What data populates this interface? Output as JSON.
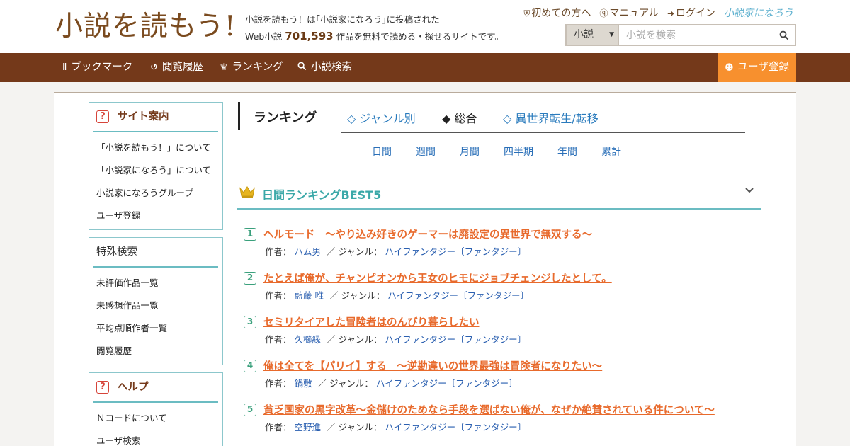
{
  "header": {
    "logo": "小説を読もう!",
    "tagline_line1": "小説を読もう！は｢小説家になろう｣に投稿された",
    "tagline_prefix": "Web小説",
    "work_count": "701,593",
    "tagline_suffix": "作品を無料で読める・探せるサイトです。",
    "links": [
      {
        "icon": "shield-icon",
        "label": "初めての方へ"
      },
      {
        "icon": "question-circle-icon",
        "label": "マニュアル"
      },
      {
        "icon": "login-icon",
        "label": "ログイン"
      }
    ],
    "narou_logo": "小説家になろう",
    "search": {
      "select_value": "小説",
      "placeholder": "小説を検索"
    }
  },
  "nav": {
    "items": [
      {
        "icon": "bookmark-icon",
        "label": "ブックマーク"
      },
      {
        "icon": "history-icon",
        "label": "閲覧履歴"
      },
      {
        "icon": "crown-icon",
        "label": "ランキング"
      },
      {
        "icon": "search-icon",
        "label": "小説検索"
      }
    ],
    "register": "ユーザ登録"
  },
  "sidebar": {
    "site_guide": {
      "title": "サイト案内",
      "items": [
        "「小説を読もう！」について",
        "「小説家になろう」について",
        "小説家になろうグループ",
        "ユーザ登録"
      ]
    },
    "special_search": {
      "title": "特殊検索",
      "items": [
        "未評価作品一覧",
        "未感想作品一覧",
        "平均点順作者一覧",
        "閲覧履歴"
      ]
    },
    "help": {
      "title": "ヘルプ",
      "items": [
        "Ｎコードについて",
        "ユーザ検索"
      ]
    }
  },
  "ranking": {
    "title": "ランキング",
    "tabs": [
      "◇ ジャンル別",
      "◆ 総合",
      "◇ 異世界転生/転移"
    ],
    "active_tab": "◆ 総合",
    "periods": [
      "日間",
      "週間",
      "月間",
      "四半期",
      "年間",
      "累計"
    ],
    "best_title": "日間ランキングBEST5",
    "author_label": "作者：",
    "genre_label": "／ ジャンル：",
    "entries": [
      {
        "rank": "1",
        "title": "ヘルモード　～やり込み好きのゲーマーは廃設定の異世界で無双する～",
        "author": "ハム男",
        "genre": "ハイファンタジー〔ファンタジー〕"
      },
      {
        "rank": "2",
        "title": "たとえば俺が、チャンピオンから王女のヒモにジョブチェンジしたとして。",
        "author": "藍藤 唯",
        "genre": "ハイファンタジー〔ファンタジー〕"
      },
      {
        "rank": "3",
        "title": "セミリタイアした冒険者はのんびり暮らしたい",
        "author": "久櫛縁",
        "genre": "ハイファンタジー〔ファンタジー〕"
      },
      {
        "rank": "4",
        "title": "俺は全てを【パリイ】する　〜逆勘違いの世界最強は冒険者になりたい〜",
        "author": "鍋敷",
        "genre": "ハイファンタジー〔ファンタジー〕"
      },
      {
        "rank": "5",
        "title": "貧乏国家の黒字改革〜金儲けのためなら手段を選ばない俺が、なぜか絶賛されている件について〜",
        "author": "空野進",
        "genre": "ハイファンタジー〔ファンタジー〕"
      }
    ]
  },
  "colors": {
    "brand_brown": "#74391a",
    "accent_orange": "#f7902e",
    "teal": "#6bbcc2",
    "title_orange": "#e86a2c",
    "link_blue": "#2a5fb0"
  }
}
